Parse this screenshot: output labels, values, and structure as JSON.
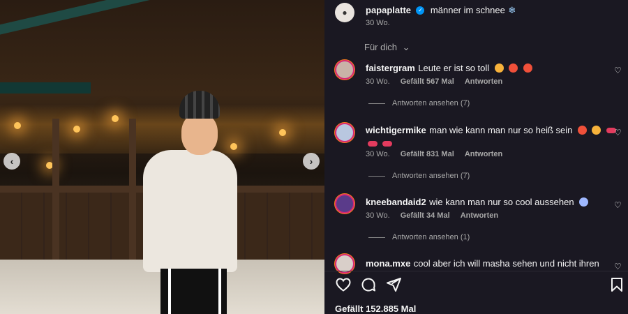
{
  "post": {
    "username": "papaplatte",
    "caption": "männer im schnee",
    "time": "30 Wo."
  },
  "filter": {
    "label": "Für dich"
  },
  "comments": [
    {
      "username": "faistergram",
      "text": "Leute er ist so toll",
      "time": "30 Wo.",
      "likes": "Gefällt 567 Mal",
      "reply": "Antworten",
      "view_replies": "Antworten ansehen (7)"
    },
    {
      "username": "wichtigermike",
      "text": "man wie kann man nur so heiß sein",
      "time": "30 Wo.",
      "likes": "Gefällt 831 Mal",
      "reply": "Antworten",
      "view_replies": "Antworten ansehen (7)"
    },
    {
      "username": "kneebandaid2",
      "text": "wie kann man nur so cool aussehen",
      "time": "30 Wo.",
      "likes": "Gefällt 34 Mal",
      "reply": "Antworten",
      "view_replies": "Antworten ansehen (1)"
    },
    {
      "username": "mona.mxe",
      "text": "cool aber ich will masha sehen und nicht ihren"
    }
  ],
  "footer": {
    "likes": "Gefällt 152.885 Mal"
  },
  "icons": {
    "like": "heart-icon",
    "comment": "comment-icon",
    "share": "share-icon",
    "save": "bookmark-icon",
    "prev": "chevron-left-icon",
    "next": "chevron-right-icon"
  },
  "colors": {
    "panel_bg": "#1a1822",
    "verified": "#0095f6"
  }
}
